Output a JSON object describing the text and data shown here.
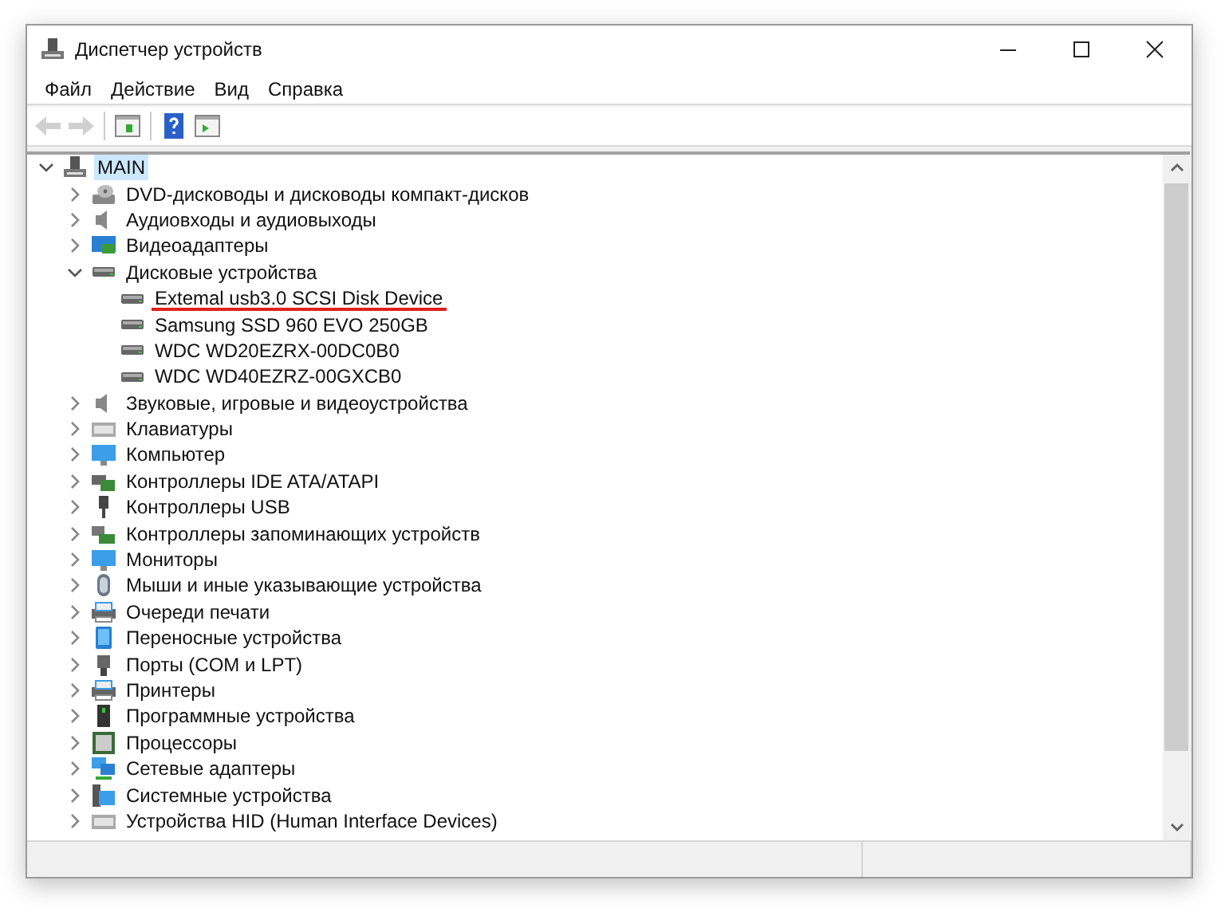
{
  "window": {
    "title": "Диспетчер устройств"
  },
  "menu": [
    "Файл",
    "Действие",
    "Вид",
    "Справка"
  ],
  "toolbar": [
    {
      "kind": "back",
      "disabled": true
    },
    {
      "kind": "forward",
      "disabled": true
    },
    {
      "kind": "separator"
    },
    {
      "kind": "properties",
      "disabled": false
    },
    {
      "kind": "separator"
    },
    {
      "kind": "help",
      "disabled": false
    },
    {
      "kind": "view",
      "disabled": false
    }
  ],
  "tree": {
    "items": [
      {
        "label": "MAIN",
        "kind": "computer",
        "selected": true,
        "expanded": true,
        "children": [
          {
            "label": "DVD-дисководы и дисководы компакт-дисков",
            "kind": "dvd",
            "selected": false,
            "expanded": false
          },
          {
            "label": "Аудиовходы и аудиовыходы",
            "kind": "audio",
            "selected": false,
            "expanded": false
          },
          {
            "label": "Видеоадаптеры",
            "kind": "display",
            "selected": false,
            "expanded": false
          },
          {
            "label": "Дисковые устройства",
            "kind": "disk",
            "selected": false,
            "expanded": true,
            "children": [
              {
                "label": "Extemal usb3.0 SCSI Disk Device",
                "kind": "disk",
                "selected": false,
                "underlined": true
              },
              {
                "label": "Samsung SSD 960 EVO 250GB",
                "kind": "disk",
                "selected": false,
                "underlined": false
              },
              {
                "label": "WDC WD20EZRX-00DC0B0",
                "kind": "disk",
                "selected": false,
                "underlined": false
              },
              {
                "label": "WDC WD40EZRZ-00GXCB0",
                "kind": "disk",
                "selected": false,
                "underlined": false
              }
            ]
          },
          {
            "label": "Звуковые, игровые и видеоустройства",
            "kind": "audio",
            "selected": false,
            "expanded": false
          },
          {
            "label": "Клавиатуры",
            "kind": "keyboard",
            "selected": false,
            "expanded": false
          },
          {
            "label": "Компьютер",
            "kind": "monitor",
            "selected": false,
            "expanded": false
          },
          {
            "label": "Контроллеры IDE ATA/ATAPI",
            "kind": "ide",
            "selected": false,
            "expanded": false
          },
          {
            "label": "Контроллеры USB",
            "kind": "usb",
            "selected": false,
            "expanded": false
          },
          {
            "label": "Контроллеры запоминающих устройств",
            "kind": "storage",
            "selected": false,
            "expanded": false
          },
          {
            "label": "Мониторы",
            "kind": "monitor",
            "selected": false,
            "expanded": false
          },
          {
            "label": "Мыши и иные указывающие устройства",
            "kind": "mouse",
            "selected": false,
            "expanded": false
          },
          {
            "label": "Очереди печати",
            "kind": "printer",
            "selected": false,
            "expanded": false
          },
          {
            "label": "Переносные устройства",
            "kind": "portable",
            "selected": false,
            "expanded": false
          },
          {
            "label": "Порты (COM и LPT)",
            "kind": "port",
            "selected": false,
            "expanded": false
          },
          {
            "label": "Принтеры",
            "kind": "printer",
            "selected": false,
            "expanded": false
          },
          {
            "label": "Программные устройства",
            "kind": "firmware",
            "selected": false,
            "expanded": false
          },
          {
            "label": "Процессоры",
            "kind": "cpu",
            "selected": false,
            "expanded": false
          },
          {
            "label": "Сетевые адаптеры",
            "kind": "network",
            "selected": false,
            "expanded": false
          },
          {
            "label": "Системные устройства",
            "kind": "system",
            "selected": false,
            "expanded": false
          },
          {
            "label": "Устройства HID (Human Interface Devices)",
            "kind": "keyboard",
            "selected": false,
            "expanded": false
          }
        ]
      }
    ]
  }
}
